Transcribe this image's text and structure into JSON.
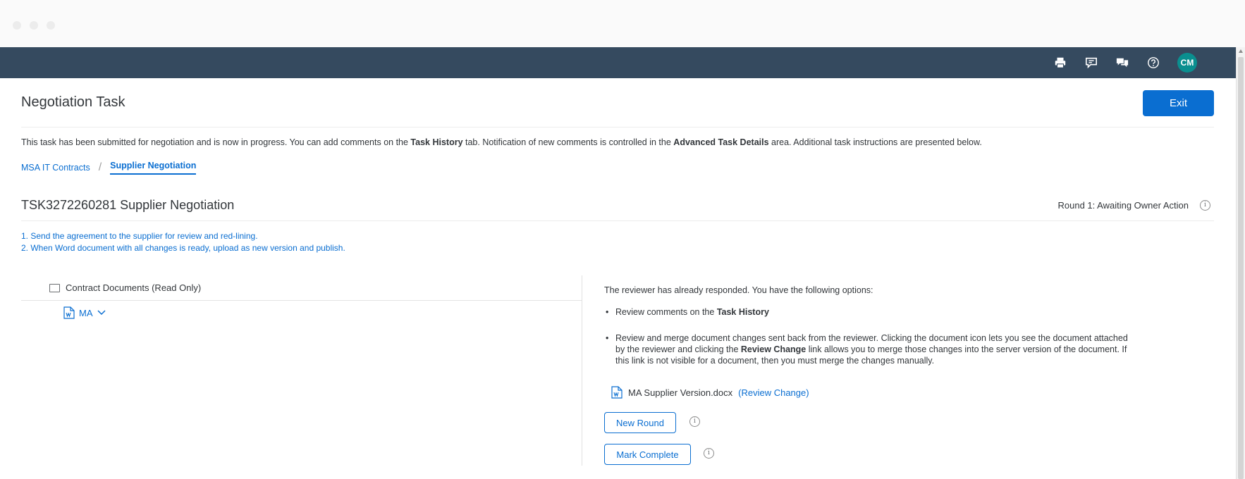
{
  "header": {
    "icons": [
      "printer-icon",
      "feedback-icon",
      "discussion-icon",
      "help-icon"
    ],
    "avatar_initials": "CM",
    "avatar_color": "#0a8f8f",
    "bar_color": "#354a5f"
  },
  "page": {
    "title": "Negotiation Task",
    "exit_label": "Exit",
    "info": {
      "part1": "This task has been submitted for negotiation and is now in progress.  You can add comments on the ",
      "bold1": "Task History",
      "part2": " tab.  Notification of new comments is controlled in the ",
      "bold2": "Advanced Task Details",
      "part3": " area.  Additional task instructions are presented below."
    },
    "breadcrumb": {
      "parent": "MSA IT Contracts",
      "separator": "/",
      "current": "Supplier Negotiation"
    }
  },
  "task": {
    "title": "TSK3272260281 Supplier Negotiation",
    "round_status": "Round 1: Awaiting Owner Action",
    "instructions": [
      "1. Send the agreement to the supplier for review and red-lining.",
      "2. When Word document with all changes is ready, upload as new version and publish."
    ]
  },
  "left_pane": {
    "title": "Contract Documents (Read Only)",
    "doc_label": "MA"
  },
  "right_pane": {
    "intro": "The reviewer has already responded. You have the following options:",
    "bullet1_prefix": "Review comments on the ",
    "bullet1_bold": "Task History",
    "bullet2_part1": "Review and merge document changes sent back from the reviewer. Clicking the document icon lets you see the document attached by the reviewer and clicking the ",
    "bullet2_bold": "Review Change",
    "bullet2_part2": " link allows you to merge those changes into the server version of the document. If this link is not visible for a document, then you must merge the changes manually.",
    "attachment_name": "MA Supplier Version.docx",
    "review_change_link": "(Review Change)",
    "new_round_label": "New Round",
    "mark_complete_label": "Mark Complete"
  },
  "colors": {
    "accent": "#0a6ed1",
    "text": "#32363a"
  }
}
